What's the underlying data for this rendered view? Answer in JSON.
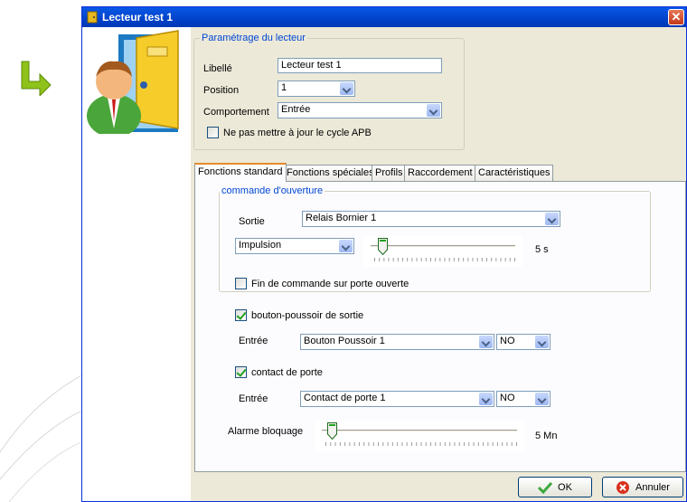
{
  "window": {
    "title": "Lecteur test 1"
  },
  "params": {
    "legend": "Paramétrage du lecteur",
    "libelle_label": "Libellé",
    "libelle_value": "Lecteur test 1",
    "position_label": "Position",
    "position_value": "1",
    "comportement_label": "Comportement",
    "comportement_value": "Entrée",
    "apb_label": "Ne pas mettre à jour le cycle APB"
  },
  "tabs": [
    "Fonctions standard",
    "Fonctions spéciales",
    "Profils",
    "Raccordement",
    "Caractéristiques"
  ],
  "commande": {
    "legend": "commande d'ouverture",
    "sortie_label": "Sortie",
    "sortie_value": "Relais Bornier 1",
    "mode_value": "Impulsion",
    "duration_text": "5 s",
    "duration_level": 0.05,
    "fin_label": "Fin de commande sur porte ouverte"
  },
  "bouton": {
    "label": "bouton-poussoir de sortie",
    "entree_label": "Entrée",
    "entree_value": "Bouton Poussoir 1",
    "state_value": "NO"
  },
  "contact": {
    "label": "contact de porte",
    "entree_label": "Entrée",
    "entree_value": "Contact de porte 1",
    "state_value": "NO"
  },
  "alarme": {
    "label": "Alarme bloquage",
    "value_text": "5 Mn",
    "level": 0.03
  },
  "buttons": {
    "ok": "OK",
    "cancel": "Annuler"
  },
  "colors": {
    "titlebar": "#0a58e6",
    "legend": "#0046d5",
    "tab_active": "#e68b2c"
  }
}
